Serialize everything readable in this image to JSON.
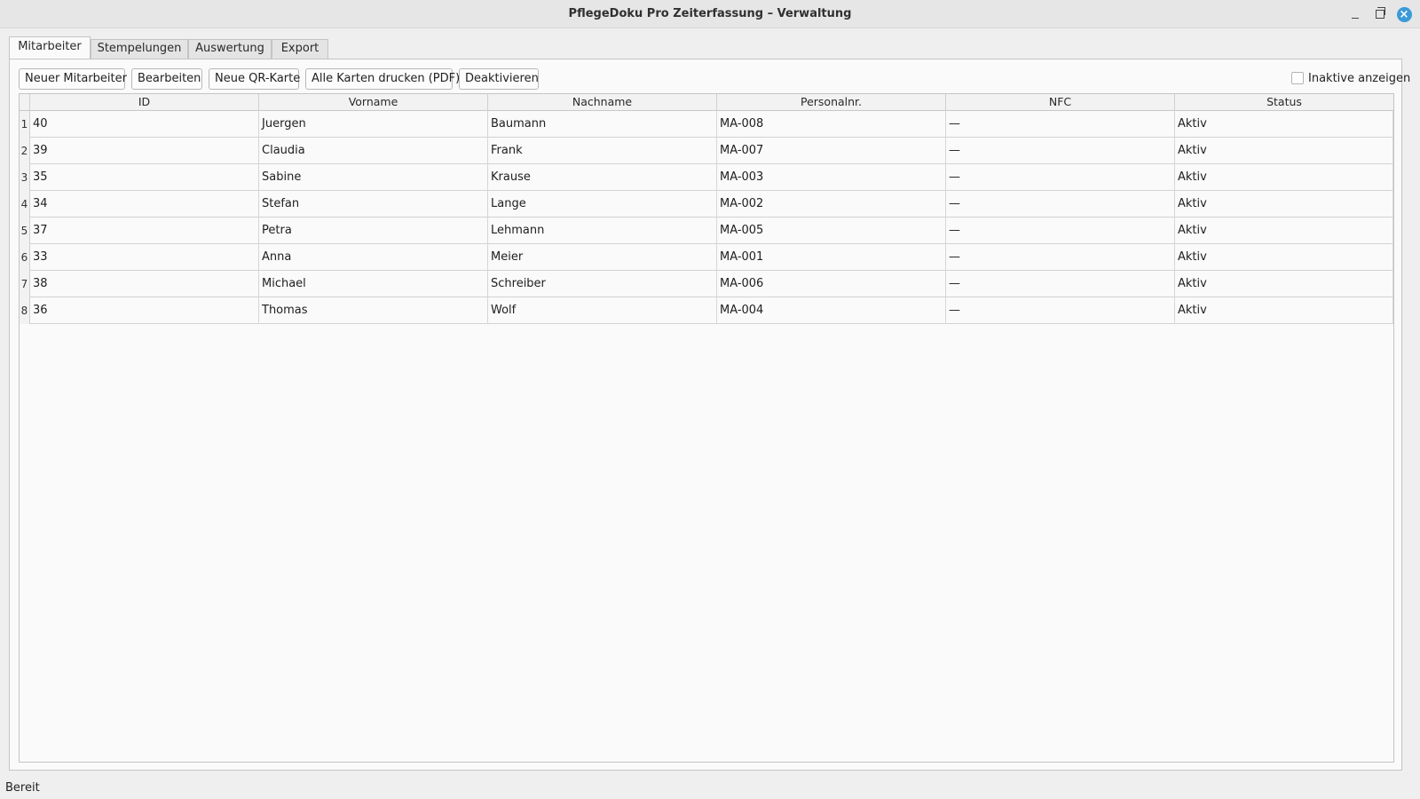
{
  "window": {
    "title": "PflegeDoku Pro Zeiterfassung – Verwaltung"
  },
  "tabs": [
    {
      "label": "Mitarbeiter",
      "active": true
    },
    {
      "label": "Stempelungen",
      "active": false
    },
    {
      "label": "Auswertung",
      "active": false
    },
    {
      "label": "Export",
      "active": false
    }
  ],
  "toolbar": {
    "new_employee": "Neuer Mitarbeiter",
    "edit": "Bearbeiten",
    "new_qr": "Neue QR-Karte",
    "print_all": "Alle Karten drucken (PDF)",
    "deactivate": "Deaktivieren",
    "show_inactive": "Inaktive anzeigen",
    "show_inactive_checked": false
  },
  "table": {
    "columns": [
      "ID",
      "Vorname",
      "Nachname",
      "Personalnr.",
      "NFC",
      "Status"
    ],
    "rows": [
      {
        "n": "1",
        "cells": [
          "40",
          "Juergen",
          "Baumann",
          "MA-008",
          "—",
          "Aktiv"
        ]
      },
      {
        "n": "2",
        "cells": [
          "39",
          "Claudia",
          "Frank",
          "MA-007",
          "—",
          "Aktiv"
        ]
      },
      {
        "n": "3",
        "cells": [
          "35",
          "Sabine",
          "Krause",
          "MA-003",
          "—",
          "Aktiv"
        ]
      },
      {
        "n": "4",
        "cells": [
          "34",
          "Stefan",
          "Lange",
          "MA-002",
          "—",
          "Aktiv"
        ]
      },
      {
        "n": "5",
        "cells": [
          "37",
          "Petra",
          "Lehmann",
          "MA-005",
          "—",
          "Aktiv"
        ]
      },
      {
        "n": "6",
        "cells": [
          "33",
          "Anna",
          "Meier",
          "MA-001",
          "—",
          "Aktiv"
        ]
      },
      {
        "n": "7",
        "cells": [
          "38",
          "Michael",
          "Schreiber",
          "MA-006",
          "—",
          "Aktiv"
        ]
      },
      {
        "n": "8",
        "cells": [
          "36",
          "Thomas",
          "Wolf",
          "MA-004",
          "—",
          "Aktiv"
        ]
      }
    ]
  },
  "statusbar": {
    "text": "Bereit"
  },
  "colors": {
    "close_button": "#3a9bd8",
    "background": "#efefef",
    "panel": "#fafafa"
  }
}
